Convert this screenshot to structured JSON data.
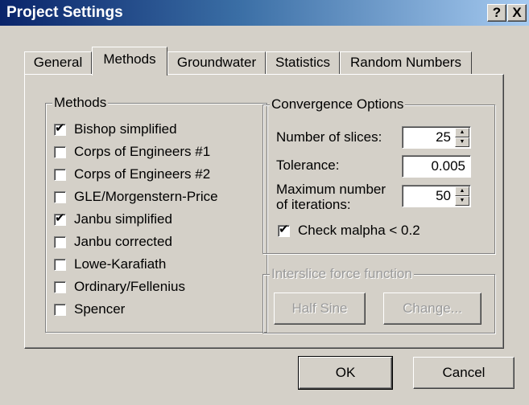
{
  "window": {
    "title": "Project Settings",
    "help_glyph": "?",
    "close_glyph": "X"
  },
  "tabs": [
    {
      "label": "General"
    },
    {
      "label": "Methods"
    },
    {
      "label": "Groundwater"
    },
    {
      "label": "Statistics"
    },
    {
      "label": "Random Numbers"
    }
  ],
  "methods": {
    "title": "Methods",
    "items": [
      {
        "label": "Bishop simplified",
        "checked": true
      },
      {
        "label": "Corps of Engineers #1",
        "checked": false
      },
      {
        "label": "Corps of Engineers #2",
        "checked": false
      },
      {
        "label": "GLE/Morgenstern-Price",
        "checked": false
      },
      {
        "label": "Janbu simplified",
        "checked": true
      },
      {
        "label": "Janbu corrected",
        "checked": false
      },
      {
        "label": "Lowe-Karafiath",
        "checked": false
      },
      {
        "label": "Ordinary/Fellenius",
        "checked": false
      },
      {
        "label": "Spencer",
        "checked": false
      }
    ]
  },
  "convergence": {
    "title": "Convergence Options",
    "slices_label": "Number of slices:",
    "slices_value": "25",
    "tolerance_label": "Tolerance:",
    "tolerance_value": "0.005",
    "max_iter_label_line1": "Maximum number",
    "max_iter_label_line2": "of iterations:",
    "max_iter_value": "50",
    "check_malpha_label": "Check malpha < 0.2",
    "check_malpha_checked": true
  },
  "interslice": {
    "title": "Interslice force function",
    "half_sine_label": "Half Sine",
    "change_label": "Change..."
  },
  "footer": {
    "ok_label": "OK",
    "cancel_label": "Cancel"
  },
  "icons": {
    "checkmark": "✔",
    "spin_up": "▲",
    "spin_down": "▼"
  }
}
